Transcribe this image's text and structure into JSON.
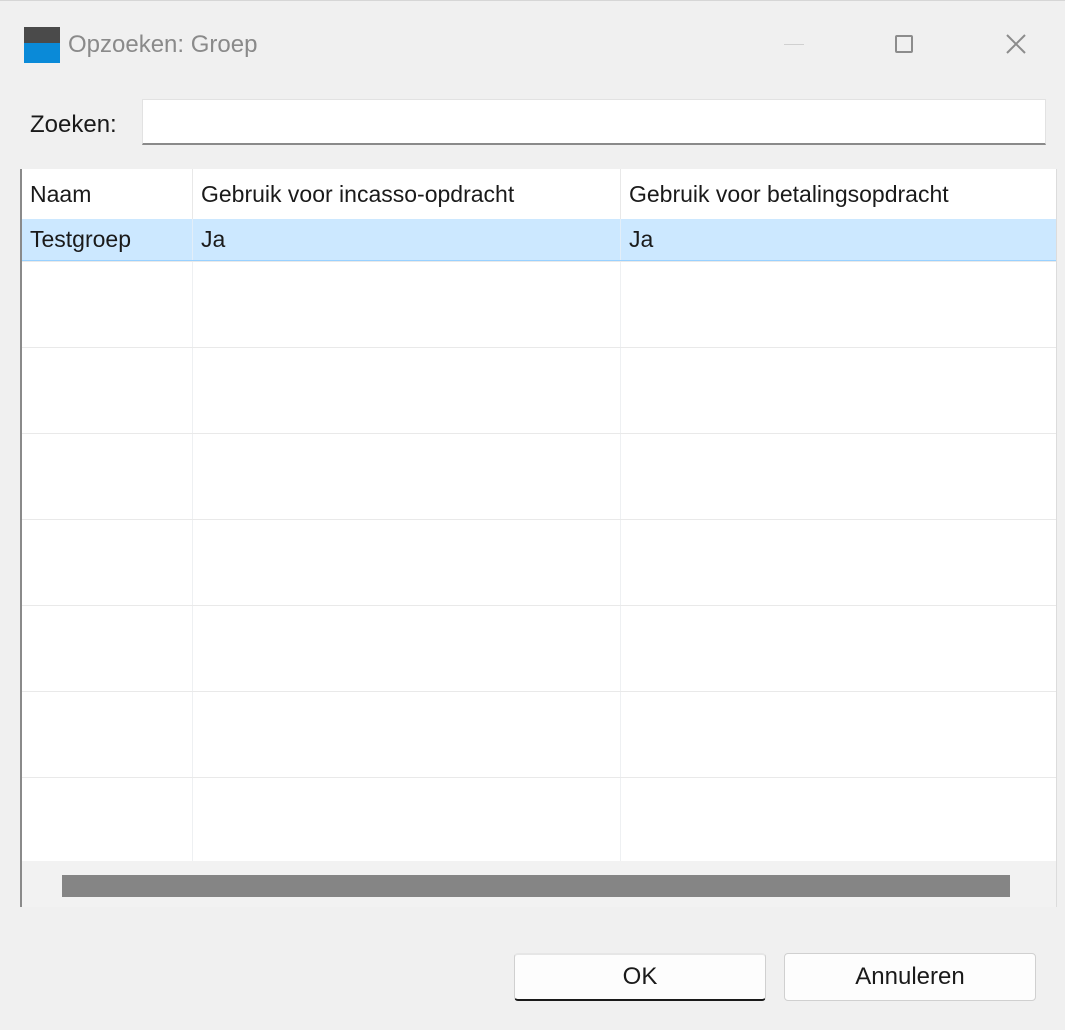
{
  "window": {
    "title": "Opzoeken: Groep"
  },
  "search": {
    "label": "Zoeken:",
    "value": "",
    "placeholder": ""
  },
  "table": {
    "columns": [
      "Naam",
      "Gebruik voor incasso-opdracht",
      "Gebruik voor betalingsopdracht"
    ],
    "rows": [
      {
        "naam": "Testgroep",
        "incasso": "Ja",
        "betaling": "Ja",
        "selected": true
      }
    ]
  },
  "buttons": {
    "ok_label": "OK",
    "cancel_label": "Annuleren"
  },
  "icons": {
    "minimize": "minimize-icon",
    "maximize": "maximize-icon",
    "close": "close-icon"
  },
  "colors": {
    "selection": "#cce8ff",
    "app_icon_top": "#4a4a4a",
    "app_icon_bottom": "#0a8ad8"
  }
}
